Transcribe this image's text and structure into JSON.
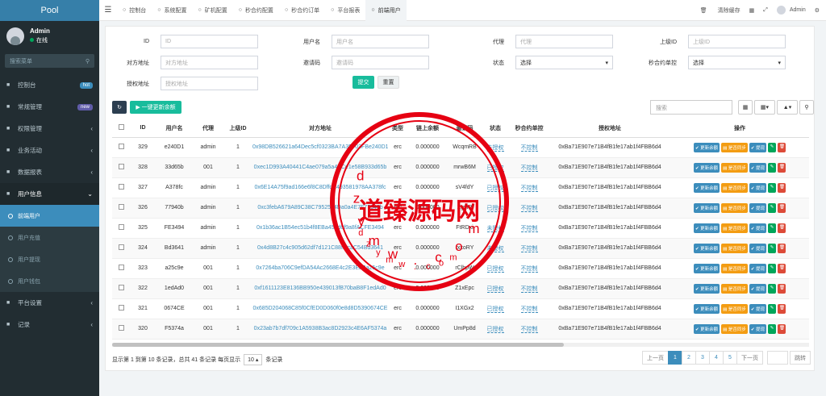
{
  "sidebar": {
    "logo": "Pool",
    "user": {
      "name": "Admin",
      "status": "在线"
    },
    "search_placeholder": "搜索菜单",
    "items": [
      {
        "label": "控制台",
        "icon": "dashboard-icon",
        "badge": "hot",
        "badge_color": "#3c8dbc"
      },
      {
        "label": "常规管理",
        "icon": "cogs-icon",
        "badge": "new",
        "badge_color": "#605ca8"
      },
      {
        "label": "权限管理",
        "icon": "group-icon",
        "arrow": "‹"
      },
      {
        "label": "业务活动",
        "icon": "bar-chart-icon",
        "arrow": "‹"
      },
      {
        "label": "数据报表",
        "icon": "list-icon",
        "arrow": "‹"
      },
      {
        "label": "用户信息",
        "icon": "user-icon",
        "arrow": "⌄",
        "open": true
      }
    ],
    "subitems": [
      {
        "label": "前端用户",
        "active": true
      },
      {
        "label": "用户充值"
      },
      {
        "label": "用户提现"
      },
      {
        "label": "用户钱包"
      }
    ],
    "bottom_items": [
      {
        "label": "平台设置",
        "icon": "gear-icon",
        "arrow": "‹"
      },
      {
        "label": "记录",
        "icon": "chart-icon",
        "arrow": "‹"
      }
    ]
  },
  "topbar": {
    "tabs": [
      {
        "label": "控制台",
        "icon": "dashboard-icon"
      },
      {
        "label": "系统配置",
        "icon": "gear-icon"
      },
      {
        "label": "矿机配置",
        "icon": "link-icon"
      },
      {
        "label": "秒合约配置",
        "icon": "circle-icon"
      },
      {
        "label": "秒合约订单",
        "icon": "circle-icon"
      },
      {
        "label": "平台报表",
        "icon": "circle-icon"
      },
      {
        "label": "前端用户",
        "icon": "circle-icon",
        "active": true
      }
    ],
    "clear_cache": "清除缓存",
    "admin": "Admin"
  },
  "filters": {
    "row1": [
      {
        "label": "ID",
        "placeholder": "ID"
      },
      {
        "label": "用户名",
        "placeholder": "用户名"
      },
      {
        "label": "代理",
        "placeholder": "代理"
      },
      {
        "label": "上级ID",
        "placeholder": "上级ID"
      }
    ],
    "row2": [
      {
        "label": "对方地址",
        "placeholder": "对方地址"
      },
      {
        "label": "邀请码",
        "placeholder": "邀请码"
      },
      {
        "label": "状态",
        "value": "选择",
        "select": true
      },
      {
        "label": "秒合约单控",
        "value": "选择",
        "select": true
      }
    ],
    "row3": [
      {
        "label": "授权地址",
        "placeholder": "授权地址"
      }
    ],
    "submit": "提交",
    "reset": "重置"
  },
  "toolbar": {
    "update_all": "一键更新余额",
    "search_placeholder": "搜索"
  },
  "table": {
    "headers": [
      "",
      "ID",
      "用户名",
      "代理",
      "上级ID",
      "对方地址",
      "类型",
      "链上余额",
      "邀请码",
      "状态",
      "秒合约单控",
      "授权地址",
      "操作"
    ],
    "rows": [
      [
        "329",
        "e240D1",
        "admin",
        "1",
        "0x98DB526621a64Dec5cf0323BA7A3F703FBe240D1",
        "erc",
        "0.000000",
        "WcqmRB",
        "未授权",
        "不控制",
        "0xBa71E907e71B4fB1fe17ab1f4FBB6d4"
      ],
      [
        "328",
        "33d65b",
        "001",
        "1",
        "0xec1D993A40441C4ae079a5a4BCe1e58B933d65b",
        "erc",
        "0.000000",
        "mrwB6M",
        "已授权",
        "不控制",
        "0xBa71E907e71B4fB1fe17ab1f4FBB6d4"
      ],
      [
        "327",
        "A378fc",
        "admin",
        "1",
        "0x6E14A75f9ad166e6f8C8DffdE493581978AA378fc",
        "erc",
        "0.000000",
        "sV4fdY",
        "已授权",
        "不控制",
        "0xBa71E907e71B4fB1fe17ab1f4FBB6d4"
      ],
      [
        "326",
        "77940b",
        "admin",
        "1",
        "0xc3febA679A89C38C7952594Da0a4E7F77940b",
        "erc",
        "0.000000",
        "ZgyIP",
        "已授权",
        "不控制",
        "0xBa71E907e71B4fB1fe17ab1f4FBB6d4"
      ],
      [
        "325",
        "FE3494",
        "admin",
        "1",
        "0x1b36ac1B54ec51b4f8EBa454d6f9a8fACFE3494",
        "erc",
        "0.000000",
        "FtRDxi",
        "未授权",
        "不控制",
        "0xBa71E907e71B4fB1fe17ab1f4FBB6d4"
      ],
      [
        "324",
        "Bd3641",
        "admin",
        "1",
        "0x4d8B27c4c905d62df7d121C88ffecaC54Bd3641",
        "erc",
        "0.000000",
        "rxxoRY",
        "未授权",
        "不控制",
        "0xBa71E907e71B4fB1fe17ab1f4FBB6d4"
      ],
      [
        "323",
        "a25c9e",
        "001",
        "1",
        "0x7264ba706C9efDA54Ac2668E4c2E3EaBa25c9e",
        "erc",
        "0.000000",
        "rClhpW",
        "已授权",
        "不控制",
        "0xBa71E907e71B4fB1fe17ab1f4FBB6d4"
      ],
      [
        "322",
        "1edAd0",
        "001",
        "1",
        "0xf1611123E8136BB950e439013fB70baB8F1edAd0",
        "erc",
        "0.000000",
        "Z1xEpc",
        "已授权",
        "不控制",
        "0xBa71E907e71B4fB1fe17ab1f4FBB6d4"
      ],
      [
        "321",
        "0674CE",
        "001",
        "1",
        "0x685D204068C85f0CfED0D060f0e8d8D5390674CE",
        "erc",
        "0.000000",
        "I1XGx2",
        "已授权",
        "不控制",
        "0xBa71E907e71B4fB1fe17ab1f4FBB6d4"
      ],
      [
        "320",
        "F5374a",
        "001",
        "1",
        "0x23ab7b7df709c1A5938B3ac8D2923c4E6AF5374a",
        "erc",
        "0.000000",
        "UmPp8d",
        "已授权",
        "不控制",
        "0xBa71E907e71B4fB1fe17ab1f4FBB6d4"
      ]
    ],
    "ops": [
      "更新余额",
      "是否同步",
      "提现"
    ]
  },
  "footer": {
    "info_prefix": "显示第 1 到第 10 条记录，总共 41 条记录 每页显示",
    "page_size": "10",
    "info_suffix": "条记录",
    "pager": [
      "上一页",
      "1",
      "2",
      "3",
      "4",
      "5",
      "下一页"
    ],
    "jump": "跳转"
  },
  "watermark": {
    "center": "道臻源码网",
    "ring": "dzymw.com",
    "color": "#e60012"
  }
}
